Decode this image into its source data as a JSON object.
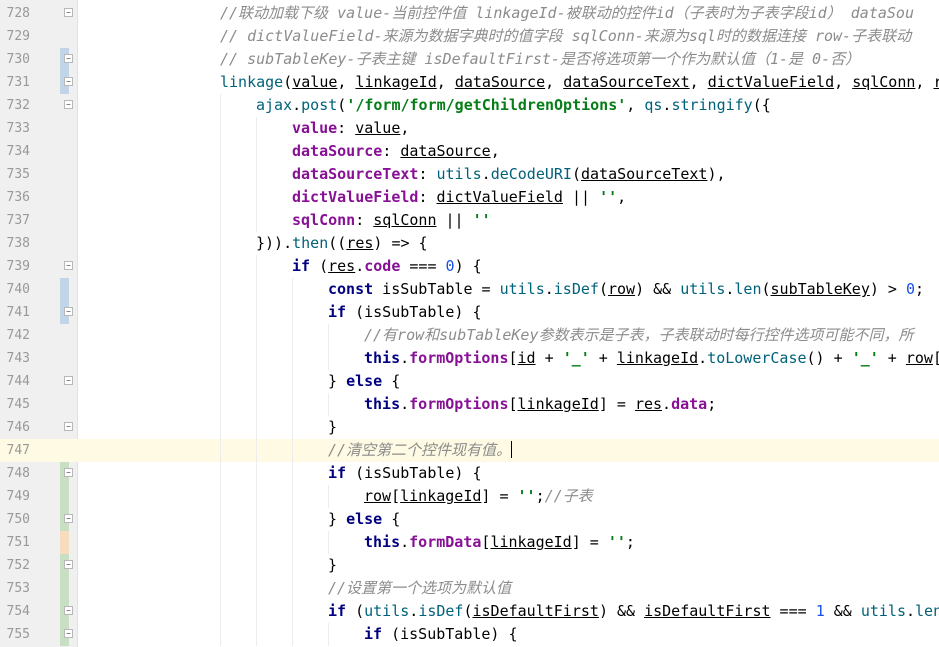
{
  "editor": {
    "current_line": 747,
    "lines": [
      {
        "num": "728",
        "indent": 0,
        "fold": "open",
        "change": "",
        "tokens": [
          {
            "t": "//联动加载下级 value-当前控件值 linkageId-被联动的控件id（子表时为子表字段id） dataSou",
            "c": "comment"
          }
        ]
      },
      {
        "num": "729",
        "indent": 0,
        "fold": "",
        "change": "",
        "tokens": [
          {
            "t": "// dictValueField-来源为数据字典时的值字段 sqlConn-来源为sql时的数据连接 row-子表联动",
            "c": "comment"
          }
        ]
      },
      {
        "num": "730",
        "indent": 0,
        "fold": "close",
        "change": "blue",
        "tokens": [
          {
            "t": "// subTableKey-子表主键 isDefaultFirst-是否将选项第一个作为默认值（1-是 0-否）",
            "c": "comment"
          }
        ]
      },
      {
        "num": "731",
        "indent": 0,
        "fold": "open",
        "change": "blue",
        "tokens": [
          {
            "t": "linkage",
            "c": "fn"
          },
          {
            "t": "(",
            "c": "p"
          },
          {
            "t": "value",
            "c": "u"
          },
          {
            "t": ", ",
            "c": "p"
          },
          {
            "t": "linkageId",
            "c": "u"
          },
          {
            "t": ", ",
            "c": "p"
          },
          {
            "t": "dataSource",
            "c": "u"
          },
          {
            "t": ", ",
            "c": "p"
          },
          {
            "t": "dataSourceText",
            "c": "u"
          },
          {
            "t": ", ",
            "c": "p"
          },
          {
            "t": "dictValueField",
            "c": "u"
          },
          {
            "t": ", ",
            "c": "p"
          },
          {
            "t": "sqlConn",
            "c": "u"
          },
          {
            "t": ", ",
            "c": "p"
          },
          {
            "t": "r",
            "c": "u"
          }
        ]
      },
      {
        "num": "732",
        "indent": 1,
        "fold": "open",
        "change": "",
        "tokens": [
          {
            "t": "ajax",
            "c": "mem"
          },
          {
            "t": ".",
            "c": "p"
          },
          {
            "t": "post",
            "c": "mem"
          },
          {
            "t": "(",
            "c": "p"
          },
          {
            "t": "'/form/form/getChildrenOptions'",
            "c": "str"
          },
          {
            "t": ", ",
            "c": "p"
          },
          {
            "t": "qs",
            "c": "mem"
          },
          {
            "t": ".",
            "c": "p"
          },
          {
            "t": "stringify",
            "c": "mem"
          },
          {
            "t": "({",
            "c": "p"
          }
        ]
      },
      {
        "num": "733",
        "indent": 2,
        "fold": "",
        "change": "",
        "tokens": [
          {
            "t": "value",
            "c": "prop"
          },
          {
            "t": ": ",
            "c": "p"
          },
          {
            "t": "value",
            "c": "u"
          },
          {
            "t": ",",
            "c": "p"
          }
        ]
      },
      {
        "num": "734",
        "indent": 2,
        "fold": "",
        "change": "",
        "tokens": [
          {
            "t": "dataSource",
            "c": "prop"
          },
          {
            "t": ": ",
            "c": "p"
          },
          {
            "t": "dataSource",
            "c": "u"
          },
          {
            "t": ",",
            "c": "p"
          }
        ]
      },
      {
        "num": "735",
        "indent": 2,
        "fold": "",
        "change": "",
        "tokens": [
          {
            "t": "dataSourceText",
            "c": "prop"
          },
          {
            "t": ": ",
            "c": "p"
          },
          {
            "t": "utils",
            "c": "mem"
          },
          {
            "t": ".",
            "c": "p"
          },
          {
            "t": "deCodeURI",
            "c": "mem"
          },
          {
            "t": "(",
            "c": "p"
          },
          {
            "t": "dataSourceText",
            "c": "u"
          },
          {
            "t": "),",
            "c": "p"
          }
        ]
      },
      {
        "num": "736",
        "indent": 2,
        "fold": "",
        "change": "",
        "tokens": [
          {
            "t": "dictValueField",
            "c": "prop"
          },
          {
            "t": ": ",
            "c": "p"
          },
          {
            "t": "dictValueField",
            "c": "u"
          },
          {
            "t": " || ",
            "c": "p"
          },
          {
            "t": "''",
            "c": "str"
          },
          {
            "t": ",",
            "c": "p"
          }
        ]
      },
      {
        "num": "737",
        "indent": 2,
        "fold": "",
        "change": "",
        "tokens": [
          {
            "t": "sqlConn",
            "c": "prop"
          },
          {
            "t": ": ",
            "c": "p"
          },
          {
            "t": "sqlConn",
            "c": "u"
          },
          {
            "t": " || ",
            "c": "p"
          },
          {
            "t": "''",
            "c": "str"
          }
        ]
      },
      {
        "num": "738",
        "indent": 1,
        "fold": "",
        "change": "",
        "tokens": [
          {
            "t": "})).",
            "c": "p"
          },
          {
            "t": "then",
            "c": "mem"
          },
          {
            "t": "((",
            "c": "p"
          },
          {
            "t": "res",
            "c": "u"
          },
          {
            "t": ") => {",
            "c": "p"
          }
        ]
      },
      {
        "num": "739",
        "indent": 2,
        "fold": "open",
        "change": "",
        "tokens": [
          {
            "t": "if",
            "c": "kw"
          },
          {
            "t": " (",
            "c": "p"
          },
          {
            "t": "res",
            "c": "u"
          },
          {
            "t": ".",
            "c": "p"
          },
          {
            "t": "code",
            "c": "prop"
          },
          {
            "t": " === ",
            "c": "p"
          },
          {
            "t": "0",
            "c": "num"
          },
          {
            "t": ") {",
            "c": "p"
          }
        ]
      },
      {
        "num": "740",
        "indent": 3,
        "fold": "",
        "change": "blue",
        "tokens": [
          {
            "t": "const",
            "c": "kw"
          },
          {
            "t": " isSubTable = ",
            "c": "p"
          },
          {
            "t": "utils",
            "c": "mem"
          },
          {
            "t": ".",
            "c": "p"
          },
          {
            "t": "isDef",
            "c": "mem"
          },
          {
            "t": "(",
            "c": "p"
          },
          {
            "t": "row",
            "c": "u"
          },
          {
            "t": ") && ",
            "c": "p"
          },
          {
            "t": "utils",
            "c": "mem"
          },
          {
            "t": ".",
            "c": "p"
          },
          {
            "t": "len",
            "c": "mem"
          },
          {
            "t": "(",
            "c": "p"
          },
          {
            "t": "subTableKey",
            "c": "u"
          },
          {
            "t": ") > ",
            "c": "p"
          },
          {
            "t": "0",
            "c": "num"
          },
          {
            "t": ";",
            "c": "p"
          }
        ]
      },
      {
        "num": "741",
        "indent": 3,
        "fold": "open",
        "change": "blue",
        "tokens": [
          {
            "t": "if",
            "c": "kw"
          },
          {
            "t": " (isSubTable) {",
            "c": "p"
          }
        ]
      },
      {
        "num": "742",
        "indent": 4,
        "fold": "",
        "change": "",
        "tokens": [
          {
            "t": "//有row和subTableKey参数表示是子表，子表联动时每行控件选项可能不同，所",
            "c": "comment"
          }
        ]
      },
      {
        "num": "743",
        "indent": 4,
        "fold": "",
        "change": "",
        "tokens": [
          {
            "t": "this",
            "c": "kw"
          },
          {
            "t": ".",
            "c": "p"
          },
          {
            "t": "formOptions",
            "c": "prop"
          },
          {
            "t": "[",
            "c": "p"
          },
          {
            "t": "id",
            "c": "u"
          },
          {
            "t": " + ",
            "c": "p"
          },
          {
            "t": "'_'",
            "c": "str"
          },
          {
            "t": " + ",
            "c": "p"
          },
          {
            "t": "linkageId",
            "c": "u"
          },
          {
            "t": ".",
            "c": "p"
          },
          {
            "t": "toLowerCase",
            "c": "mem"
          },
          {
            "t": "() + ",
            "c": "p"
          },
          {
            "t": "'_'",
            "c": "str"
          },
          {
            "t": " + ",
            "c": "p"
          },
          {
            "t": "row",
            "c": "u"
          },
          {
            "t": "[",
            "c": "p"
          }
        ]
      },
      {
        "num": "744",
        "indent": 3,
        "fold": "open",
        "change": "",
        "tokens": [
          {
            "t": "} ",
            "c": "p"
          },
          {
            "t": "else",
            "c": "kw"
          },
          {
            "t": " {",
            "c": "p"
          }
        ]
      },
      {
        "num": "745",
        "indent": 4,
        "fold": "",
        "change": "",
        "tokens": [
          {
            "t": "this",
            "c": "kw"
          },
          {
            "t": ".",
            "c": "p"
          },
          {
            "t": "formOptions",
            "c": "prop"
          },
          {
            "t": "[",
            "c": "p"
          },
          {
            "t": "linkageId",
            "c": "u"
          },
          {
            "t": "] = ",
            "c": "p"
          },
          {
            "t": "res",
            "c": "u"
          },
          {
            "t": ".",
            "c": "p"
          },
          {
            "t": "data",
            "c": "prop"
          },
          {
            "t": ";",
            "c": "p"
          }
        ]
      },
      {
        "num": "746",
        "indent": 3,
        "fold": "close",
        "change": "",
        "tokens": [
          {
            "t": "}",
            "c": "p"
          }
        ]
      },
      {
        "num": "747",
        "indent": 3,
        "fold": "",
        "change": "",
        "caret": true,
        "tokens": [
          {
            "t": "//清空第二个控件现有值。",
            "c": "comment"
          }
        ]
      },
      {
        "num": "748",
        "indent": 3,
        "fold": "open",
        "change": "green",
        "tokens": [
          {
            "t": "if",
            "c": "kw"
          },
          {
            "t": " (isSubTable) {",
            "c": "p"
          }
        ]
      },
      {
        "num": "749",
        "indent": 4,
        "fold": "",
        "change": "green",
        "tokens": [
          {
            "t": "row",
            "c": "u"
          },
          {
            "t": "[",
            "c": "p"
          },
          {
            "t": "linkageId",
            "c": "u"
          },
          {
            "t": "] = ",
            "c": "p"
          },
          {
            "t": "''",
            "c": "str"
          },
          {
            "t": ";",
            "c": "p"
          },
          {
            "t": "//子表",
            "c": "comment"
          }
        ]
      },
      {
        "num": "750",
        "indent": 3,
        "fold": "open",
        "change": "green",
        "tokens": [
          {
            "t": "} ",
            "c": "p"
          },
          {
            "t": "else",
            "c": "kw"
          },
          {
            "t": " {",
            "c": "p"
          }
        ]
      },
      {
        "num": "751",
        "indent": 4,
        "fold": "",
        "change": "orange",
        "tokens": [
          {
            "t": "this",
            "c": "kw"
          },
          {
            "t": ".",
            "c": "p"
          },
          {
            "t": "formData",
            "c": "prop"
          },
          {
            "t": "[",
            "c": "p"
          },
          {
            "t": "linkageId",
            "c": "u"
          },
          {
            "t": "] = ",
            "c": "p"
          },
          {
            "t": "''",
            "c": "str"
          },
          {
            "t": ";",
            "c": "p"
          }
        ]
      },
      {
        "num": "752",
        "indent": 3,
        "fold": "close",
        "change": "green",
        "tokens": [
          {
            "t": "}",
            "c": "p"
          }
        ]
      },
      {
        "num": "753",
        "indent": 3,
        "fold": "",
        "change": "green",
        "tokens": [
          {
            "t": "//设置第一个选项为默认值",
            "c": "comment"
          }
        ]
      },
      {
        "num": "754",
        "indent": 3,
        "fold": "open",
        "change": "green",
        "tokens": [
          {
            "t": "if",
            "c": "kw"
          },
          {
            "t": " (",
            "c": "p"
          },
          {
            "t": "utils",
            "c": "mem"
          },
          {
            "t": ".",
            "c": "p"
          },
          {
            "t": "isDef",
            "c": "mem"
          },
          {
            "t": "(",
            "c": "p"
          },
          {
            "t": "isDefaultFirst",
            "c": "u"
          },
          {
            "t": ") && ",
            "c": "p"
          },
          {
            "t": "isDefaultFirst",
            "c": "u"
          },
          {
            "t": " === ",
            "c": "p"
          },
          {
            "t": "1",
            "c": "num"
          },
          {
            "t": " && ",
            "c": "p"
          },
          {
            "t": "utils",
            "c": "mem"
          },
          {
            "t": ".",
            "c": "p"
          },
          {
            "t": "len",
            "c": "mem"
          }
        ]
      },
      {
        "num": "755",
        "indent": 4,
        "fold": "open",
        "change": "green",
        "tokens": [
          {
            "t": "if",
            "c": "kw"
          },
          {
            "t": " (isSubTable) {",
            "c": "p"
          }
        ]
      }
    ]
  }
}
